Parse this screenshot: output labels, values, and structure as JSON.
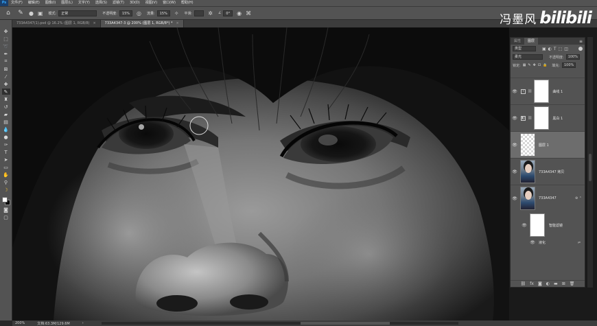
{
  "menubar": {
    "logo": "Ps",
    "items": [
      "文件(F)",
      "编辑(E)",
      "图像(I)",
      "图层(L)",
      "文字(Y)",
      "选择(S)",
      "滤镜(T)",
      "3D(D)",
      "视图(V)",
      "窗口(W)",
      "帮助(H)"
    ]
  },
  "options": {
    "mode_label": "模式:",
    "mode_value": "正常",
    "opacity_label": "不透明度:",
    "opacity_value": "15%",
    "flow_label": "流量:",
    "flow_value": "15%",
    "smooth_label": "平滑:",
    "angle_value": "0°"
  },
  "watermark": {
    "name": "冯墨风",
    "brand": "bilibili"
  },
  "tabs": [
    {
      "label": "733A4347(1).psd @ 16.2% (图层 1, RGB/8)",
      "active": false
    },
    {
      "label": "733A4347-3 @ 200% (图层 1, RGB/8*) *",
      "active": true
    }
  ],
  "tools": [
    "move",
    "marquee",
    "lasso",
    "quick-select",
    "crop",
    "frame",
    "eyedropper",
    "healing",
    "brush",
    "stamp",
    "history-brush",
    "eraser",
    "gradient",
    "blur",
    "dodge",
    "pen",
    "type",
    "path-select",
    "rectangle",
    "hand",
    "zoom",
    "banana",
    "swatches",
    "quick-mask",
    "screen-mode",
    "extra"
  ],
  "panel": {
    "tab_inactive": "属性",
    "tab_active": "图层",
    "filter_dropdown": "类型",
    "blend_dropdown": "柔光",
    "opacity_label": "不透明度:",
    "opacity_value": "100%",
    "lock_label": "锁定:",
    "fill_label": "填充:",
    "fill_value": "100%"
  },
  "layers": [
    {
      "name": "曲线 1",
      "kind": "curves"
    },
    {
      "name": "黑白 1",
      "kind": "bw"
    },
    {
      "name": "图层 1",
      "kind": "empty",
      "selected": true
    },
    {
      "name": "733A4347 拷贝",
      "kind": "photo"
    },
    {
      "name": "733A4347",
      "kind": "photo-smart"
    }
  ],
  "smart_filters": {
    "mask_label": "智能滤镜",
    "filter_name": "液化"
  },
  "status": {
    "zoom": "200%",
    "doc": "文档:63.3M/129.6M"
  }
}
